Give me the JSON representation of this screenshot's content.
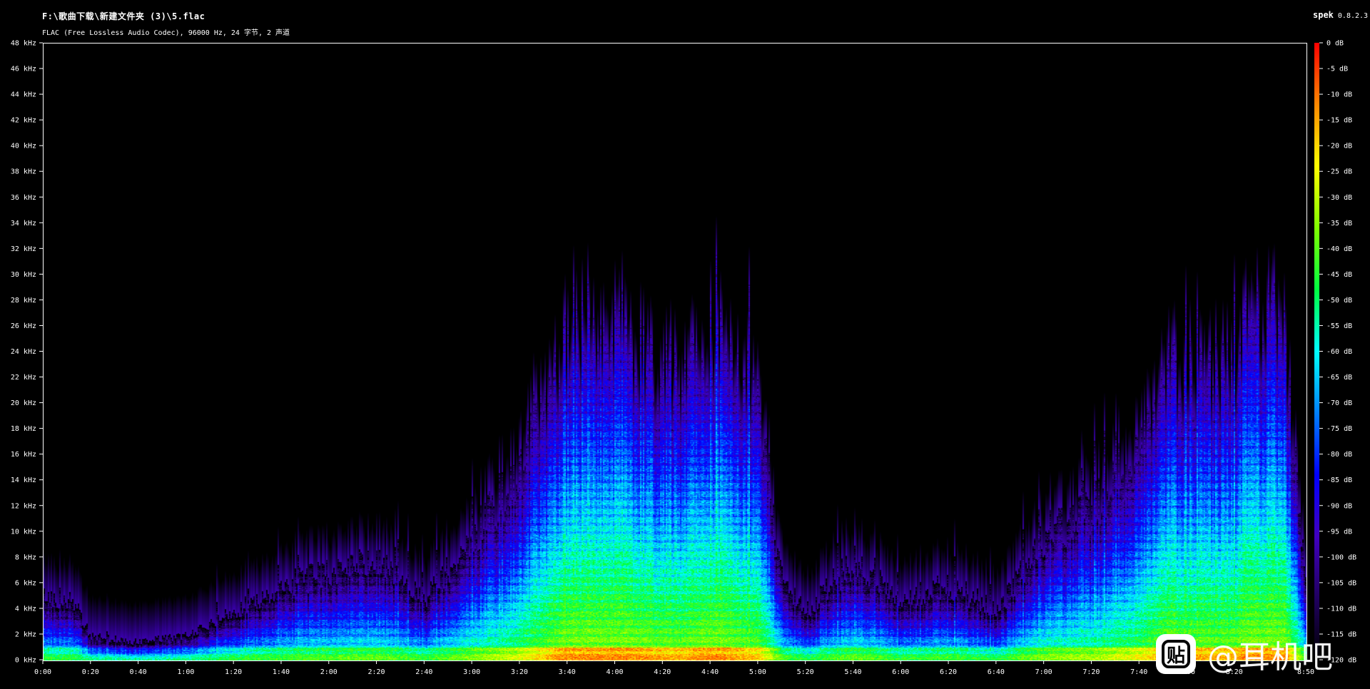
{
  "window": {
    "title": "F:\\歌曲下载\\新建文件夹 (3)\\5.flac",
    "subtitle": "FLAC (Free Lossless Audio Codec), 96000 Hz, 24 字节, 2 声道",
    "app_name": "spek",
    "app_version": "0.8.2.3"
  },
  "watermark": {
    "icon": "tieba-paw-icon",
    "logo_glyph": "贴",
    "text": "@耳机吧"
  },
  "chart_data": {
    "type": "heatmap",
    "x_axis": {
      "unit": "time (m:ss)",
      "min_seconds": 0,
      "max_seconds": 530,
      "tick_labels": [
        "0:00",
        "0:20",
        "0:40",
        "1:00",
        "1:20",
        "1:40",
        "2:00",
        "2:20",
        "2:40",
        "3:00",
        "3:20",
        "3:40",
        "4:00",
        "4:20",
        "4:40",
        "5:00",
        "5:20",
        "5:40",
        "6:00",
        "6:20",
        "6:40",
        "7:00",
        "7:20",
        "7:40",
        "8:00",
        "8:20",
        "8:50"
      ],
      "tick_seconds": [
        0,
        20,
        40,
        60,
        80,
        100,
        120,
        140,
        160,
        180,
        200,
        220,
        240,
        260,
        280,
        300,
        320,
        340,
        360,
        380,
        400,
        420,
        440,
        460,
        480,
        500,
        530
      ]
    },
    "y_axis": {
      "unit": "kHz",
      "min": 0,
      "max": 48,
      "tick_labels": [
        "0 kHz",
        "2 kHz",
        "4 kHz",
        "6 kHz",
        "8 kHz",
        "10 kHz",
        "12 kHz",
        "14 kHz",
        "16 kHz",
        "18 kHz",
        "20 kHz",
        "22 kHz",
        "24 kHz",
        "26 kHz",
        "28 kHz",
        "30 kHz",
        "32 kHz",
        "34 kHz",
        "36 kHz",
        "38 kHz",
        "40 kHz",
        "42 kHz",
        "44 kHz",
        "46 kHz",
        "48 kHz"
      ],
      "tick_values": [
        0,
        2,
        4,
        6,
        8,
        10,
        12,
        14,
        16,
        18,
        20,
        22,
        24,
        26,
        28,
        30,
        32,
        34,
        36,
        38,
        40,
        42,
        44,
        46,
        48
      ]
    },
    "colorbar": {
      "unit": "dB",
      "min": -120,
      "max": 0,
      "tick_labels": [
        "0 dB",
        "-5 dB",
        "-10 dB",
        "-15 dB",
        "-20 dB",
        "-25 dB",
        "-30 dB",
        "-35 dB",
        "-40 dB",
        "-45 dB",
        "-50 dB",
        "-55 dB",
        "-60 dB",
        "-65 dB",
        "-70 dB",
        "-75 dB",
        "-80 dB",
        "-85 dB",
        "-90 dB",
        "-95 dB",
        "-100 dB",
        "-105 dB",
        "-110 dB",
        "-115 dB",
        "-120 dB"
      ],
      "tick_values": [
        0,
        -5,
        -10,
        -15,
        -20,
        -25,
        -30,
        -35,
        -40,
        -45,
        -50,
        -55,
        -60,
        -65,
        -70,
        -75,
        -80,
        -85,
        -90,
        -95,
        -100,
        -105,
        -110,
        -115,
        -120
      ],
      "colors_high_to_low": [
        "#ff0000",
        "#ff8800",
        "#ffff00",
        "#80ff00",
        "#00ff40",
        "#00ffff",
        "#0080ff",
        "#0000ff",
        "#4000c0",
        "#200060",
        "#000000"
      ]
    },
    "content_profile": {
      "description_units": "seconds -> approximate upper frequency extent in kHz",
      "time_seconds": [
        0,
        10,
        20,
        40,
        60,
        80,
        100,
        120,
        140,
        160,
        180,
        200,
        210,
        220,
        240,
        260,
        270,
        280,
        300,
        310,
        320,
        340,
        360,
        380,
        400,
        420,
        440,
        460,
        470,
        480,
        500,
        505,
        520,
        530
      ],
      "upper_khz": [
        5,
        5,
        2,
        1.5,
        2,
        4,
        6,
        7,
        8,
        5,
        10,
        15,
        20,
        25,
        25,
        22,
        22,
        25,
        20,
        6,
        4,
        8,
        5,
        6,
        4,
        10,
        12,
        17,
        22,
        22,
        22,
        26,
        26,
        5
      ]
    }
  }
}
